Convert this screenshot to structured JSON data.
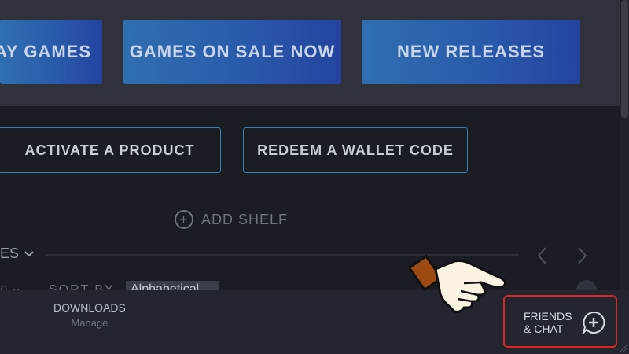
{
  "categories": [
    {
      "label": "AY GAMES"
    },
    {
      "label": "GAMES ON SALE NOW"
    },
    {
      "label": "NEW RELEASES"
    }
  ],
  "actions": {
    "activate_label": "ACTIVATE A PRODUCT",
    "redeem_label": "REDEEM A WALLET CODE"
  },
  "shelf": {
    "add_label": "ADD SHELF",
    "title_fragment": "ES",
    "sort_label": "SORT BY",
    "sort_value": "Alphabetical"
  },
  "bottom": {
    "downloads_title": "DOWNLOADS",
    "downloads_sub": "Manage",
    "friends_line1": "FRIENDS",
    "friends_line2": "& CHAT"
  },
  "colors": {
    "highlight_border": "#d92525",
    "accent_blue": "#2a5aab"
  }
}
